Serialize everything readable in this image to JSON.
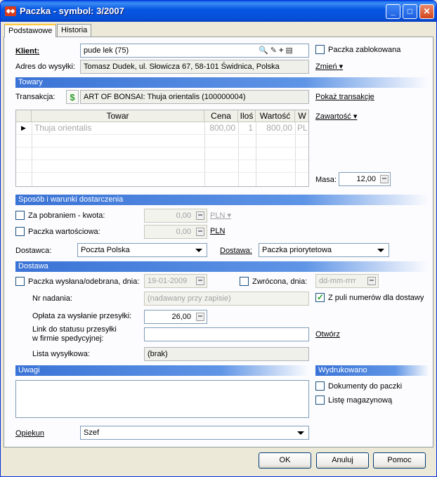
{
  "window": {
    "app_icon": "app-logo-icon",
    "title": "Paczka - symbol: 3/2007",
    "minimize": "_",
    "maximize": "□",
    "close": "✕"
  },
  "tabs": [
    {
      "label": "Podstawowe",
      "active": true
    },
    {
      "label": "Historia",
      "active": false
    }
  ],
  "klient": {
    "label": "Klient:",
    "value": "pude lek (75)",
    "icons": [
      "search-icon",
      "edit-icon",
      "add-icon",
      "list-icon"
    ]
  },
  "zablokowana": {
    "label": "Paczka zablokowana",
    "checked": false
  },
  "adres": {
    "label": "Adres do wysyłki:",
    "value": "Tomasz Dudek, ul. Słowicza 67, 58-101 Świdnica, Polska",
    "change_link": "Zmień"
  },
  "towary": {
    "header": "Towary",
    "transakcja_label": "Transakcja:",
    "transakcja_icon": "dollar-icon",
    "transakcja_value": "ART OF BONSAI: Thuja orientalis (100000004)",
    "pokaz_link": "Pokaż transakcje",
    "zawartosc_link": "Zawartość",
    "columns": [
      "Towar",
      "Cena",
      "Iloś",
      "Wartość",
      "W"
    ],
    "rows": [
      {
        "towar": "Thuja orientalis",
        "cena": "800,00",
        "ilosc": "1",
        "wartosc": "800,00",
        "w": "PL"
      }
    ],
    "masa_label": "Masa:",
    "masa_value": "12,00"
  },
  "dostarczenie": {
    "header": "Sposób i warunki dostarczenia",
    "pobranie_label": "Za pobraniem - kwota:",
    "pobranie_checked": false,
    "pobranie_value": "0,00",
    "pobranie_currency": "PLN",
    "wartosciowa_label": "Paczka wartościowa:",
    "wartosciowa_checked": false,
    "wartosciowa_value": "0,00",
    "wartosciowa_currency": "PLN",
    "dostawca_label": "Dostawca:",
    "dostawca_value": "Poczta Polska",
    "dostawa_label": "Dostawa:",
    "dostawa_value": "Paczka priorytetowa"
  },
  "dostawa": {
    "header": "Dostawa",
    "wyslana_label": "Paczka wysłana/odebrana, dnia:",
    "wyslana_checked": false,
    "wyslana_date": "19-01-2009",
    "zwrocona_label": "Zwrócona, dnia:",
    "zwrocona_checked": false,
    "zwrocona_placeholder": "dd-mm-rrrr",
    "nr_label": "Nr nadania:",
    "nr_placeholder": "(nadawany przy zapisie)",
    "z_puli_label": "Z puli numerów dla dostawy",
    "z_puli_checked": true,
    "oplata_label": "Opłata za wysłanie przesyłki:",
    "oplata_value": "26,00",
    "link_label_1": "Link do statusu przesyłki",
    "link_label_2": "w firmie spedycyjnej:",
    "link_value": "",
    "otworz_link": "Otwórz",
    "lista_label": "Lista wysyłkowa:",
    "lista_value": "(brak)"
  },
  "uwagi": {
    "header": "Uwagi",
    "value": ""
  },
  "wydrukowano": {
    "header": "Wydrukowano",
    "dokumenty_label": "Dokumenty do paczki",
    "dokumenty_checked": false,
    "lista_mag_label": "Listę magazynową",
    "lista_mag_checked": false
  },
  "opiekun": {
    "label": "Opiekun",
    "value": "Szef"
  },
  "buttons": {
    "ok": "OK",
    "anuluj": "Anuluj",
    "pomoc": "Pomoc"
  }
}
